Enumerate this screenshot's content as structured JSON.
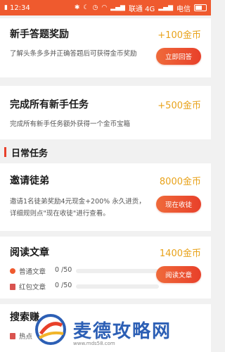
{
  "status_bar": {
    "time": "12:34",
    "network": "联通 4G",
    "carrier": "电信"
  },
  "tasks": [
    {
      "title": "新手答题奖励",
      "reward": "+100金币",
      "description": "了解头条多多并正确答题后可获得金币奖励",
      "button": "立即回答"
    },
    {
      "title": "完成所有新手任务",
      "reward": "+500金币",
      "description": "完成所有新手任务额外获得一个金币宝箱"
    }
  ],
  "daily_section": "日常任务",
  "daily_tasks": [
    {
      "title": "邀请徒弟",
      "reward": "8000金币",
      "description": "邀请1名徒弟奖励4元现金+200% 永久进贡，详细规则点\"现在收徒\"进行查看。",
      "button": "现在收徒"
    },
    {
      "title": "阅读文章",
      "reward": "1400金币",
      "button": "阅读文章",
      "items": [
        {
          "label": "普通文章",
          "count": "0 /50",
          "progress": 0
        },
        {
          "label": "红包文章",
          "count": "0 /50",
          "progress": 0
        }
      ]
    },
    {
      "title": "搜索赚",
      "subtitle": "热点"
    }
  ],
  "watermark": {
    "text": "麦德攻略网",
    "url": "www.mds58.com"
  },
  "colors": {
    "accent": "#ef5a2e",
    "reward": "#e8a21a"
  }
}
